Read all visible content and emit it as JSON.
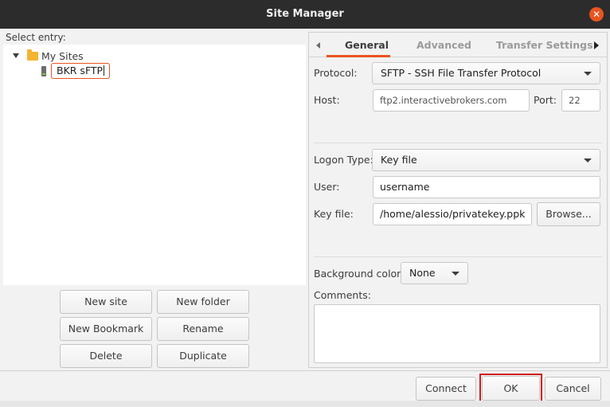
{
  "window": {
    "title": "Site Manager"
  },
  "left": {
    "select_label": "Select entry:",
    "tree": {
      "folder_label": "My Sites",
      "site_label": "BKR sFTP"
    },
    "buttons": {
      "new_site": "New site",
      "new_folder": "New folder",
      "new_bookmark": "New Bookmark",
      "rename": "Rename",
      "delete": "Delete",
      "duplicate": "Duplicate"
    }
  },
  "tabs": [
    {
      "label": "General",
      "active": true
    },
    {
      "label": "Advanced",
      "active": false
    },
    {
      "label": "Transfer Settings",
      "active": false
    }
  ],
  "general": {
    "protocol_label": "Protocol:",
    "protocol_value": "SFTP - SSH File Transfer Protocol",
    "host_label": "Host:",
    "host_value": "ftp2.interactivebrokers.com",
    "port_label": "Port:",
    "port_value": "22",
    "logon_type_label": "Logon Type:",
    "logon_type_value": "Key file",
    "user_label": "User:",
    "user_value": "username",
    "key_file_label": "Key file:",
    "key_file_value": "/home/alessio/privatekey.ppk",
    "browse_label": "Browse...",
    "bg_color_label": "Background color:",
    "bg_color_value": "None",
    "comments_label": "Comments:"
  },
  "footer": {
    "connect": "Connect",
    "ok": "OK",
    "cancel": "Cancel"
  },
  "colors": {
    "accent": "#e95420",
    "highlight_frame": "#d01b1b",
    "titlebar": "#2c2c2c"
  },
  "icons": [
    "close-icon",
    "expand-arrow-icon",
    "folder-icon",
    "site-icon",
    "tab-scroll-left-icon",
    "tab-scroll-right-icon",
    "chevron-down-icon"
  ]
}
